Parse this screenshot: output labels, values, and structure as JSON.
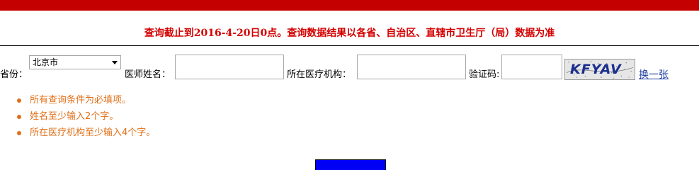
{
  "notice": {
    "text": "查询截止到2016-4-20日0点。查询数据结果以各省、自治区、直辖市卫生厅（局）数据为准"
  },
  "form": {
    "province_label": "省份：",
    "province_value": "北京市",
    "name_label": "医师姓名：",
    "name_value": "",
    "org_label": "所在医疗机构：",
    "org_value": "",
    "captcha_label": "验证码:",
    "captcha_value": "",
    "captcha_text": "KFYAV",
    "refresh_link": "换一张"
  },
  "rules": [
    "所有查询条件为必填项。",
    "姓名至少输入2个字。",
    "所在医疗机构至少输入4个字。"
  ],
  "colors": {
    "top_bar": "#c40000",
    "notice": "#d40000",
    "rules": "#e0701a",
    "submit_button": "#0000f5",
    "link": "#1a3aa0"
  }
}
